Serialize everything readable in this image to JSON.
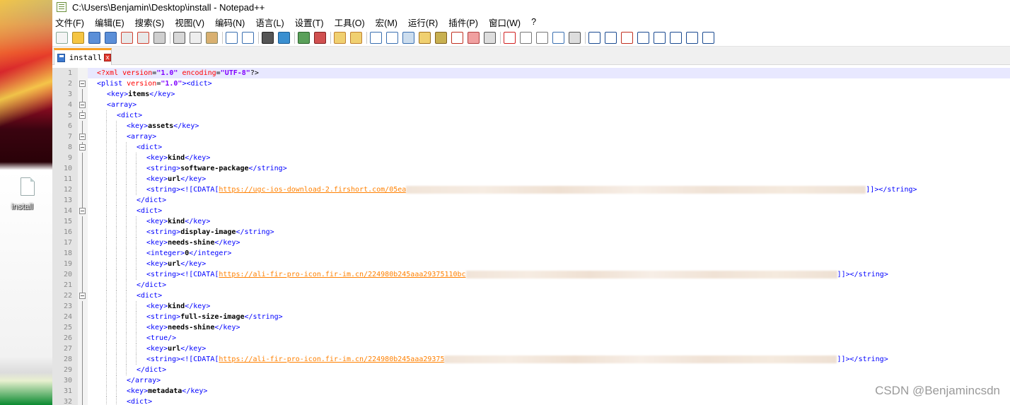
{
  "desktop": {
    "file_label": "install"
  },
  "window": {
    "title": "C:\\Users\\Benjamin\\Desktop\\install - Notepad++"
  },
  "menu": [
    "文件(F)",
    "编辑(E)",
    "搜索(S)",
    "视图(V)",
    "编码(N)",
    "语言(L)",
    "设置(T)",
    "工具(O)",
    "宏(M)",
    "运行(R)",
    "插件(P)",
    "窗口(W)",
    "?"
  ],
  "tab": {
    "label": "install",
    "close": "x"
  },
  "lines": [
    {
      "n": "1",
      "text": "<?xml version=\"1.0\" encoding=\"UTF-8\"?>"
    },
    {
      "n": "2",
      "text": "<plist version=\"1.0\"><dict>"
    },
    {
      "n": "3",
      "text": "<key>items</key>"
    },
    {
      "n": "4",
      "text": "<array>"
    },
    {
      "n": "5",
      "text": "<dict>"
    },
    {
      "n": "6",
      "text": "<key>assets</key>"
    },
    {
      "n": "7",
      "text": "<array>"
    },
    {
      "n": "8",
      "text": "<dict>"
    },
    {
      "n": "9",
      "text": "<key>kind</key>"
    },
    {
      "n": "10",
      "text": "<string>software-package</string>"
    },
    {
      "n": "11",
      "text": "<key>url</key>"
    },
    {
      "n": "12",
      "text": "<string><![CDATA[https://ugc-ios-download-2.firshort.com/05ea]]></string>"
    },
    {
      "n": "13",
      "text": "</dict>"
    },
    {
      "n": "14",
      "text": "<dict>"
    },
    {
      "n": "15",
      "text": "<key>kind</key>"
    },
    {
      "n": "16",
      "text": "<string>display-image</string>"
    },
    {
      "n": "17",
      "text": "<key>needs-shine</key>"
    },
    {
      "n": "18",
      "text": "<integer>0</integer>"
    },
    {
      "n": "19",
      "text": "<key>url</key>"
    },
    {
      "n": "20",
      "text": "<string><![CDATA[https://ali-fir-pro-icon.fir-im.cn/224980b245aaa29375110bc]]></string>"
    },
    {
      "n": "21",
      "text": "</dict>"
    },
    {
      "n": "22",
      "text": "<dict>"
    },
    {
      "n": "23",
      "text": "<key>kind</key>"
    },
    {
      "n": "24",
      "text": "<string>full-size-image</string>"
    },
    {
      "n": "25",
      "text": "<key>needs-shine</key>"
    },
    {
      "n": "26",
      "text": "<true/>"
    },
    {
      "n": "27",
      "text": "<key>url</key>"
    },
    {
      "n": "28",
      "text": "<string><![CDATA[https://ali-fir-pro-icon.fir-im.cn/224980b245aaa29375]]></string>"
    },
    {
      "n": "29",
      "text": "</dict>"
    },
    {
      "n": "30",
      "text": "</array>"
    },
    {
      "n": "31",
      "text": "<key>metadata</key>"
    },
    {
      "n": "32",
      "text": "<dict>"
    }
  ],
  "watermark": "CSDN @Benjamincsdn"
}
